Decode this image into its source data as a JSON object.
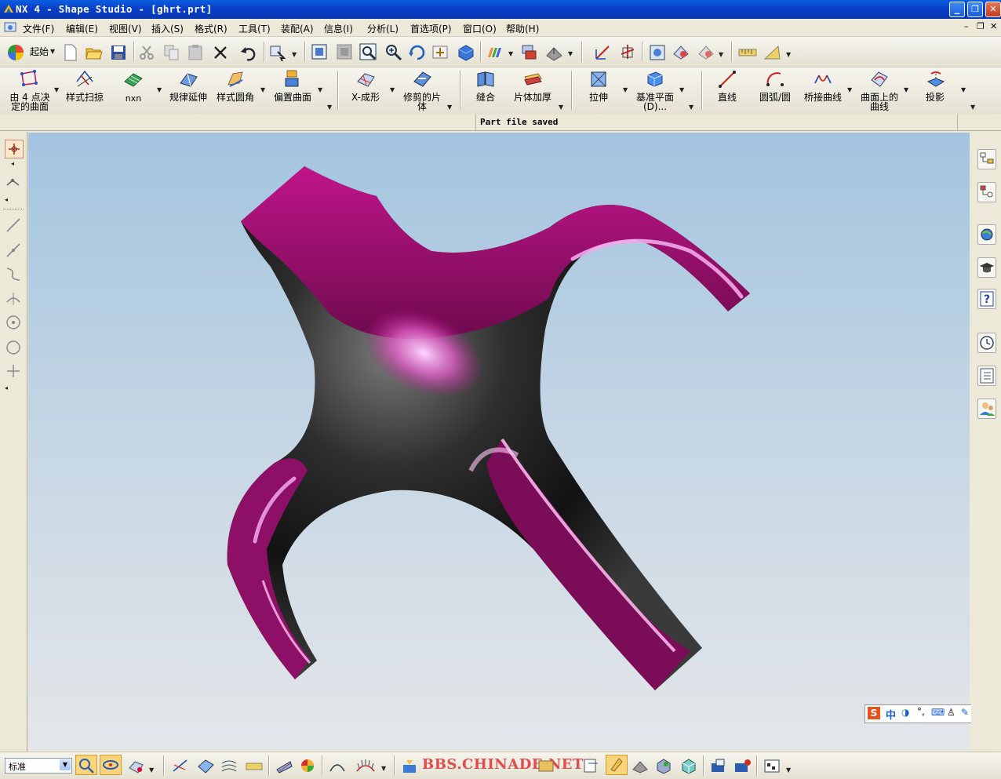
{
  "window": {
    "title": "NX 4 - Shape Studio - [ghrt.prt]",
    "minimize": "_",
    "restore": "❐",
    "close": "✕"
  },
  "menubar": {
    "items": [
      "文件(F)",
      "编辑(E)",
      "视图(V)",
      "插入(S)",
      "格式(R)",
      "工具(T)",
      "装配(A)",
      "信息(I)",
      "分析(L)",
      "首选项(P)",
      "窗口(O)",
      "帮助(H)"
    ]
  },
  "toolbar1": {
    "start_label": "起始"
  },
  "toolbar2": {
    "items": [
      {
        "label": "由 4 点决\n定的曲面",
        "icon": "four-point-surface-icon"
      },
      {
        "label": "样式扫掠",
        "icon": "styled-sweep-icon"
      },
      {
        "label": "nxn",
        "icon": "nxn-surface-icon"
      },
      {
        "label": "规律延伸",
        "icon": "law-extension-icon"
      },
      {
        "label": "样式圆角",
        "icon": "styled-blend-icon"
      },
      {
        "label": "偏置曲面",
        "icon": "offset-surface-icon"
      },
      {
        "label": "X-成形",
        "icon": "x-form-icon"
      },
      {
        "label": "修剪的片\n体",
        "icon": "trimmed-sheet-icon"
      },
      {
        "label": "缝合",
        "icon": "sew-icon"
      },
      {
        "label": "片体加厚",
        "icon": "thicken-sheet-icon"
      },
      {
        "label": "拉伸",
        "icon": "extrude-icon"
      },
      {
        "label": "基准平面\n(D)...",
        "icon": "datum-plane-icon"
      },
      {
        "label": "直线",
        "icon": "line-icon"
      },
      {
        "label": "圆弧/圆",
        "icon": "arc-circle-icon"
      },
      {
        "label": "桥接曲线",
        "icon": "bridge-curve-icon"
      },
      {
        "label": "曲面上的\n曲线",
        "icon": "curve-on-surface-icon"
      },
      {
        "label": "投影",
        "icon": "project-curve-icon"
      }
    ]
  },
  "status": {
    "message": "Part file saved"
  },
  "bottombar": {
    "role": "标准",
    "watermark": "BBS.CHINADE.NET"
  },
  "ime": {
    "text": "中"
  },
  "colors": {
    "titlebar": "#0A3FC8",
    "model_magenta": "#B0127A",
    "viewport_top": "#A3C4DF",
    "viewport_bottom": "#E4E6E9"
  }
}
